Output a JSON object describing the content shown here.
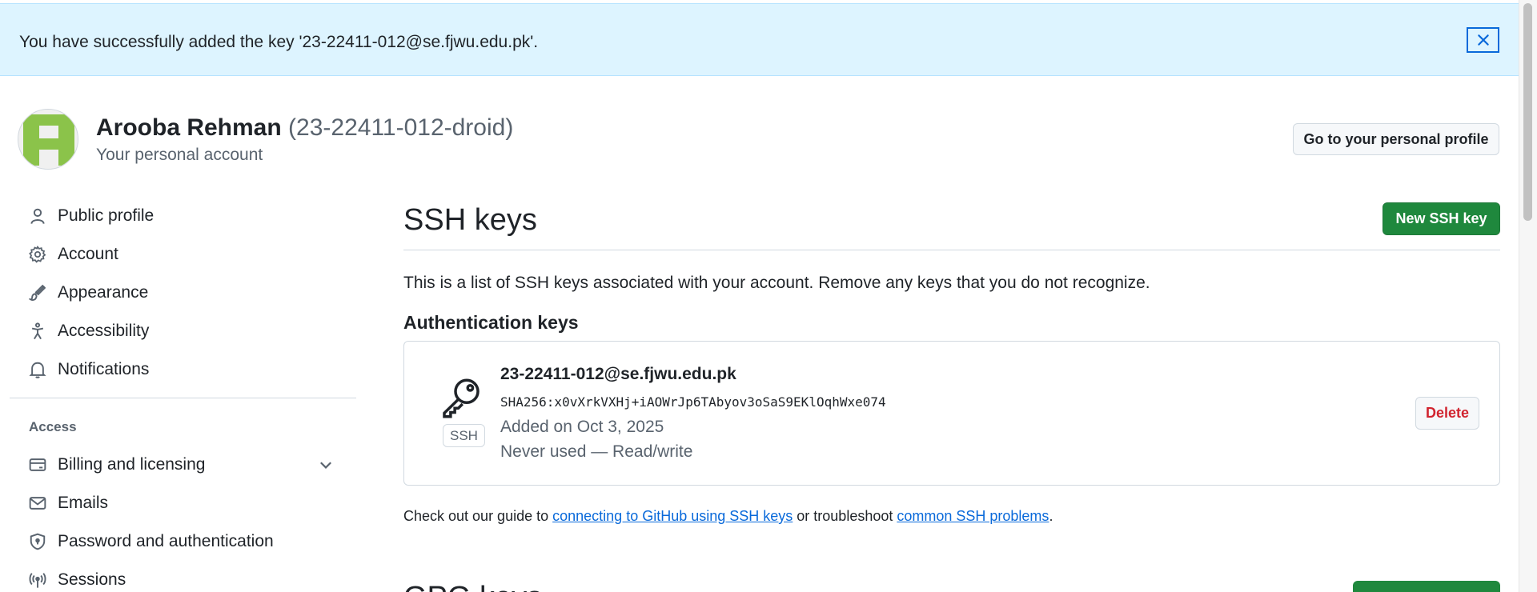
{
  "flash": {
    "message": "You have successfully added the key '23-22411-012@se.fjwu.edu.pk'."
  },
  "header": {
    "name": "Arooba Rehman",
    "login": "(23-22411-012-droid)",
    "subtitle": "Your personal account",
    "profile_button": "Go to your personal profile"
  },
  "sidebar": {
    "items": [
      {
        "label": "Public profile",
        "icon": "person-icon"
      },
      {
        "label": "Account",
        "icon": "gear-icon"
      },
      {
        "label": "Appearance",
        "icon": "paintbrush-icon"
      },
      {
        "label": "Accessibility",
        "icon": "accessibility-icon"
      },
      {
        "label": "Notifications",
        "icon": "bell-icon"
      }
    ],
    "access_heading": "Access",
    "access_items": [
      {
        "label": "Billing and licensing",
        "icon": "credit-card-icon"
      },
      {
        "label": "Emails",
        "icon": "mail-icon"
      },
      {
        "label": "Password and authentication",
        "icon": "shield-lock-icon"
      },
      {
        "label": "Sessions",
        "icon": "broadcast-icon"
      }
    ]
  },
  "main": {
    "title": "SSH keys",
    "new_button": "New SSH key",
    "intro": "This is a list of SSH keys associated with your account. Remove any keys that you do not recognize.",
    "auth_heading": "Authentication keys",
    "key": {
      "title": "23-22411-012@se.fjwu.edu.pk",
      "fingerprint": "SHA256:x0vXrkVXHj+iAOWrJp6TAbyov3oSaS9EKlOqhWxe074",
      "badge": "SSH",
      "added": "Added on Oct 3, 2025",
      "usage": "Never used — Read/write",
      "delete_button": "Delete"
    },
    "guide": {
      "prefix": "Check out our guide to ",
      "link1": "connecting to GitHub using SSH keys",
      "middle": " or troubleshoot ",
      "link2": "common SSH problems",
      "suffix": "."
    },
    "next_section_title": "GPG keys"
  },
  "colors": {
    "flash_bg": "#ddf4ff",
    "primary_button": "#1f883d",
    "link": "#0969da",
    "danger": "#d1242f",
    "avatar_green": "#8bc34a"
  }
}
